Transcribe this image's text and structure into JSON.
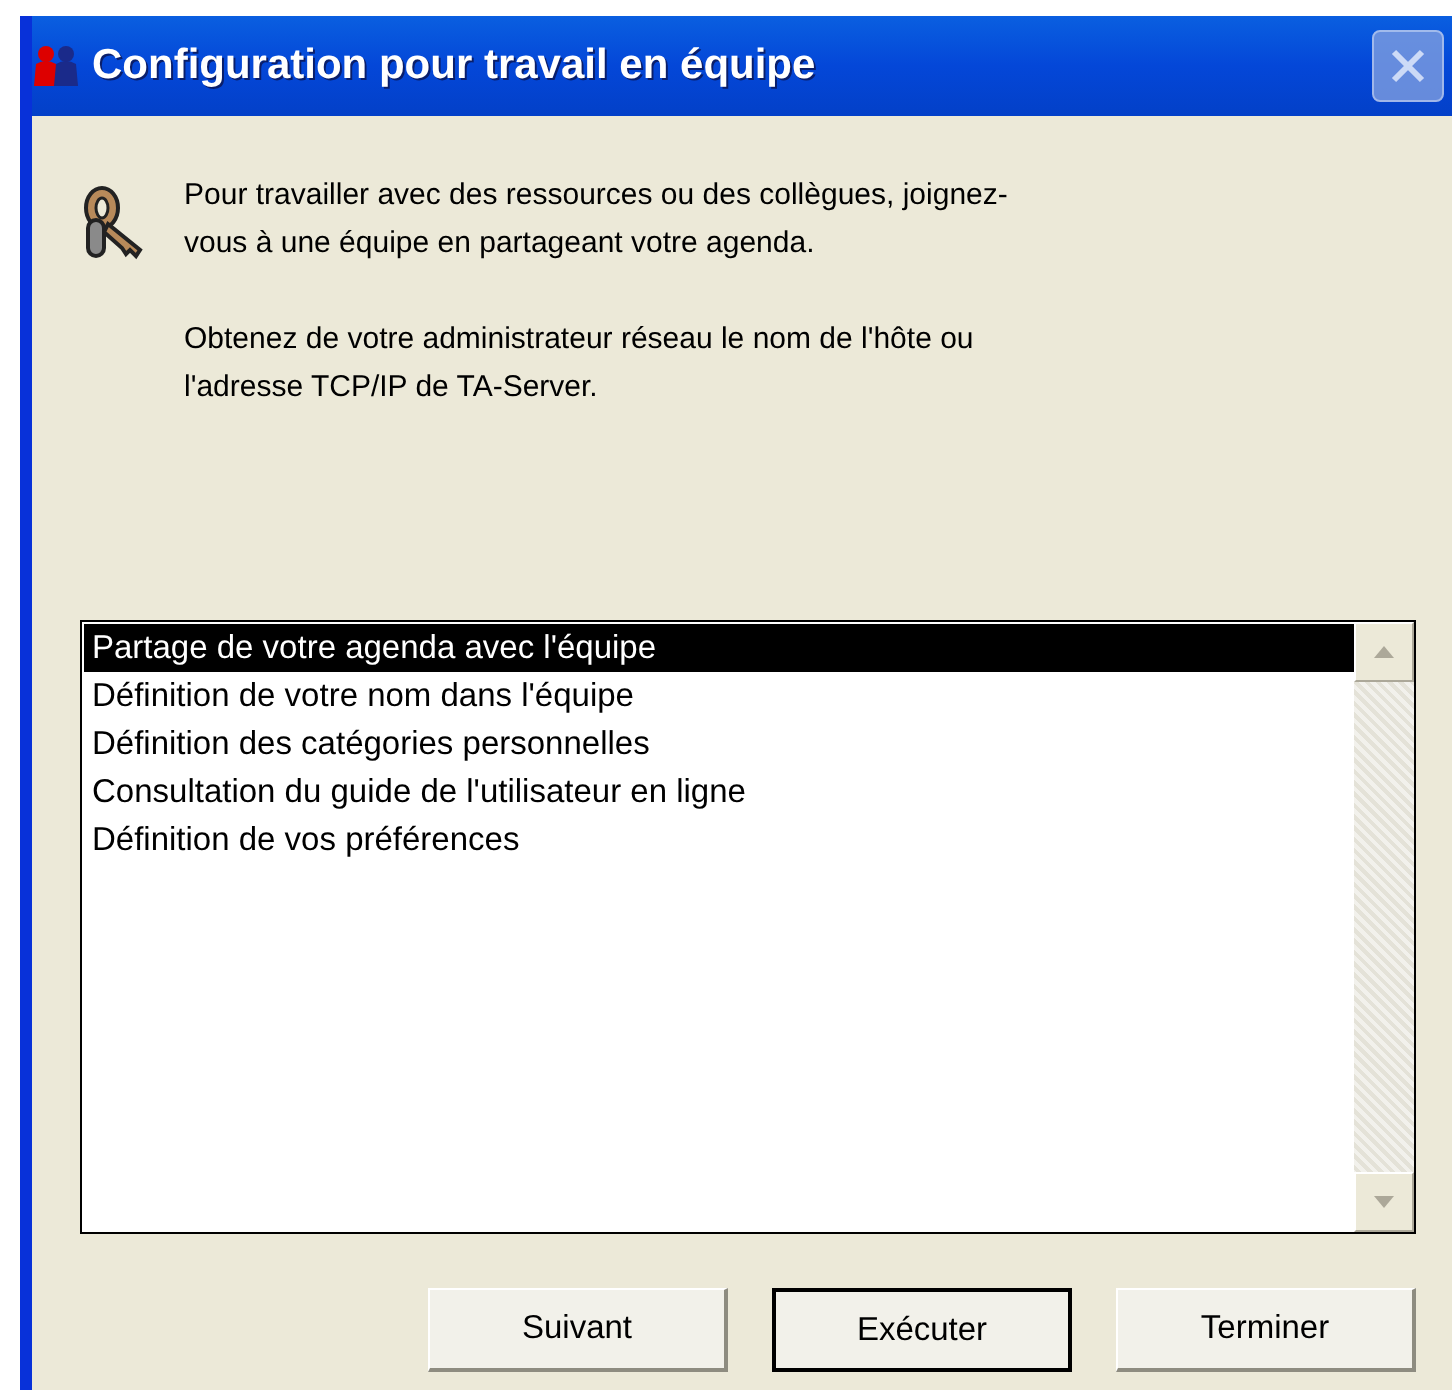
{
  "window": {
    "title": "Configuration pour travail en équipe",
    "close_disabled": true
  },
  "intro": [
    "Pour travailler avec des ressources ou des collègues, joignez-vous à une équipe en partageant votre agenda.",
    "Obtenez de votre administrateur réseau le nom de l'hôte ou l'adresse TCP/IP de TA-Server."
  ],
  "tasks": [
    {
      "label": "Partage de votre agenda avec l'équipe",
      "selected": true
    },
    {
      "label": "Définition de votre nom dans l'équipe",
      "selected": false
    },
    {
      "label": "Définition des catégories personnelles",
      "selected": false
    },
    {
      "label": "Consultation du guide de l'utilisateur en ligne",
      "selected": false
    },
    {
      "label": "Définition de vos préférences",
      "selected": false
    }
  ],
  "buttons": [
    {
      "label": "Suivant",
      "default": false
    },
    {
      "label": "Exécuter",
      "default": true
    },
    {
      "label": "Terminer",
      "default": false
    }
  ]
}
